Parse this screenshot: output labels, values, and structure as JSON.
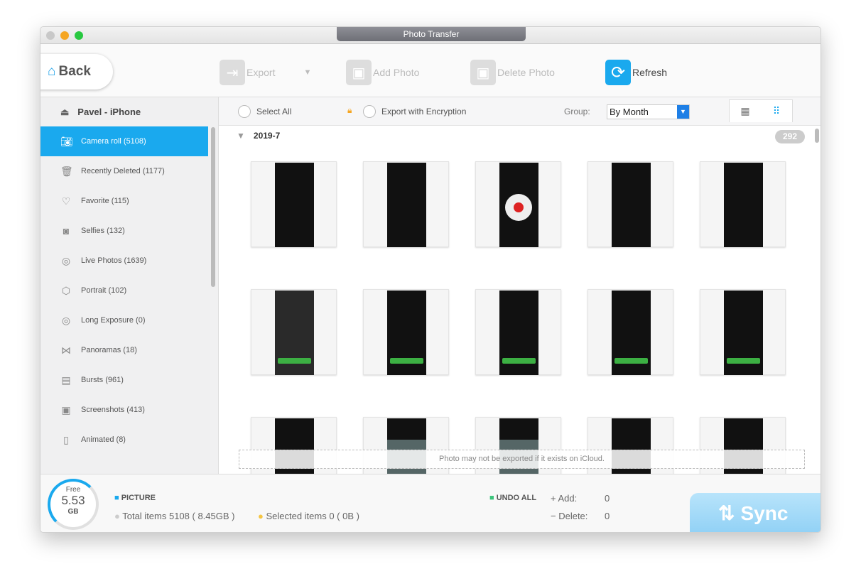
{
  "window": {
    "title": "Photo Transfer"
  },
  "toolbar": {
    "back": "Back",
    "export": "Export",
    "add_photo": "Add Photo",
    "delete_photo": "Delete Photo",
    "refresh": "Refresh"
  },
  "sidebar": {
    "device": "Pavel - iPhone",
    "items": [
      {
        "label": "Camera roll (5108)",
        "icon": "camera-icon"
      },
      {
        "label": "Recently Deleted (1177)",
        "icon": "trash-icon"
      },
      {
        "label": "Favorite (115)",
        "icon": "heart-icon"
      },
      {
        "label": "Selfies (132)",
        "icon": "selfie-icon"
      },
      {
        "label": "Live Photos (1639)",
        "icon": "live-photo-icon"
      },
      {
        "label": "Portrait (102)",
        "icon": "cube-icon"
      },
      {
        "label": "Long Exposure (0)",
        "icon": "long-exposure-icon"
      },
      {
        "label": "Panoramas (18)",
        "icon": "panorama-icon"
      },
      {
        "label": "Bursts (961)",
        "icon": "bursts-icon"
      },
      {
        "label": "Screenshots (413)",
        "icon": "screenshot-icon"
      },
      {
        "label": "Animated (8)",
        "icon": "animated-icon"
      }
    ]
  },
  "content": {
    "select_all": "Select All",
    "export_encryption": "Export with Encryption",
    "group_label": "Group:",
    "group_value": "By Month",
    "group_title": "2019-7",
    "group_count": "292",
    "notice": "Photo may not be exported if it exists on iCloud."
  },
  "bottom": {
    "free_label": "Free",
    "free_value": "5.53",
    "free_unit": "GB",
    "category": "PICTURE",
    "total": "Total items 5108 ( 8.45GB )",
    "selected": "Selected items 0 ( 0B )",
    "undo_all": "UNDO ALL",
    "add_label": "+ Add:",
    "add_value": "0",
    "delete_label": "− Delete:",
    "delete_value": "0",
    "sync": "Sync"
  },
  "colors": {
    "accent": "#1aa9ee",
    "close": "#c8c8c8",
    "minimize": "#f5a623",
    "zoom": "#28c840"
  }
}
